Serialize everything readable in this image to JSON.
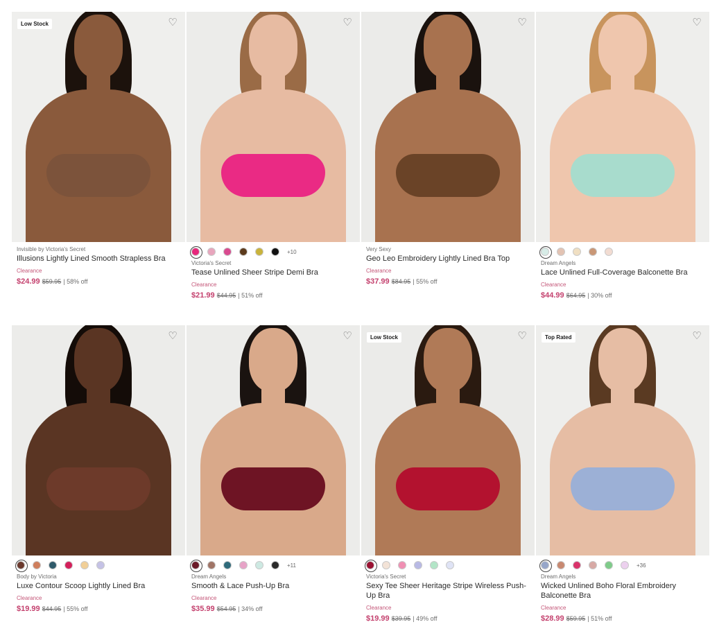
{
  "products": [
    {
      "badge": "Low Stock",
      "swatches": [],
      "more": "",
      "brand": "Invisible by Victoria's Secret",
      "name": "Illusions Lightly Lined Smooth Strapless Bra",
      "tag": "Clearance",
      "price_now": "$24.99",
      "price_was": "$59.95",
      "discount": "| 58% off",
      "colors": {
        "bg": "#efefed",
        "skin": "#8a5a3c",
        "hair": "#1c120c",
        "garment": "#7c533b"
      }
    },
    {
      "badge": "",
      "swatches": [
        "#e7287c",
        "#e8a6bd",
        "#d94a8f",
        "#5c3b1c",
        "#c9b33c",
        "#111111"
      ],
      "more": "+10",
      "brand": "Victoria's Secret",
      "name": "Tease Unlined Sheer Stripe Demi Bra",
      "tag": "Clearance",
      "price_now": "$21.99",
      "price_was": "$44.95",
      "discount": "| 51% off",
      "colors": {
        "bg": "#ececea",
        "skin": "#e7bba2",
        "hair": "#9a6b46",
        "garment": "#ea2a84"
      }
    },
    {
      "badge": "",
      "swatches": [],
      "more": "",
      "brand": "Very Sexy",
      "name": "Geo Leo Embroidery Lightly Lined Bra Top",
      "tag": "Clearance",
      "price_now": "$37.99",
      "price_was": "$84.95",
      "discount": "| 55% off",
      "colors": {
        "bg": "#ebebe9",
        "skin": "#a8724f",
        "hair": "#1a120e",
        "garment": "#6a4327"
      }
    },
    {
      "badge": "",
      "swatches": [
        "#d7ece7",
        "#e3c3b3",
        "#f0dfc2",
        "#c99776",
        "#f2dcd2"
      ],
      "more": "",
      "brand": "Dream Angels",
      "name": "Lace Unlined Full-Coverage Balconette Bra",
      "tag": "Clearance",
      "price_now": "$44.99",
      "price_was": "$64.95",
      "discount": "| 30% off",
      "colors": {
        "bg": "#eeeeec",
        "skin": "#efc6ad",
        "hair": "#c8945d",
        "garment": "#a8dccd"
      }
    },
    {
      "badge": "",
      "swatches": [
        "#6b3a2e",
        "#cf7f5d",
        "#2f5a6a",
        "#d3205b",
        "#f1cf97",
        "#c5c2e6"
      ],
      "more": "",
      "brand": "Body by Victoria",
      "name": "Luxe Contour Scoop Lightly Lined Bra",
      "tag": "Clearance",
      "price_now": "$19.99",
      "price_was": "$44.95",
      "discount": "| 55% off",
      "colors": {
        "bg": "#ececea",
        "skin": "#5a3523",
        "hair": "#140c08",
        "garment": "#6d3a2a"
      }
    },
    {
      "badge": "",
      "swatches": [
        "#6a1a28",
        "#a07466",
        "#2f6a7a",
        "#e7a3c7",
        "#cde9e2",
        "#2a2a2a"
      ],
      "more": "+11",
      "brand": "Dream Angels",
      "name": "Smooth & Lace Push-Up Bra",
      "tag": "Clearance",
      "price_now": "$35.99",
      "price_was": "$54.95",
      "discount": "| 34% off",
      "colors": {
        "bg": "#ececea",
        "skin": "#d9a98a",
        "hair": "#1a1310",
        "garment": "#6e1424"
      }
    },
    {
      "badge": "Low Stock",
      "swatches": [
        "#9a1232",
        "#f3e3d7",
        "#f08fb3",
        "#b8b9e4",
        "#b3e5c7",
        "#dfe3f5"
      ],
      "more": "",
      "brand": "Victoria's Secret",
      "name": "Sexy Tee Sheer Heritage Stripe Wireless Push-Up Bra",
      "tag": "Clearance",
      "price_now": "$19.99",
      "price_was": "$39.95",
      "discount": "| 49% off",
      "colors": {
        "bg": "#ebebe9",
        "skin": "#b07a57",
        "hair": "#2a1a10",
        "garment": "#b3122f"
      }
    },
    {
      "badge": "Top Rated",
      "swatches": [
        "#97a6c9",
        "#c88971",
        "#d9336b",
        "#d7a9a5",
        "#7fcb8a",
        "#ecd0ee"
      ],
      "more": "+36",
      "brand": "Dream Angels",
      "name": "Wicked Unlined Boho Floral Embroidery Balconette Bra",
      "tag": "Clearance",
      "price_now": "$28.99",
      "price_was": "$59.95",
      "discount": "| 51% off",
      "colors": {
        "bg": "#eeeeec",
        "skin": "#e6bda4",
        "hair": "#5a3a22",
        "garment": "#9cb0d6"
      }
    }
  ]
}
